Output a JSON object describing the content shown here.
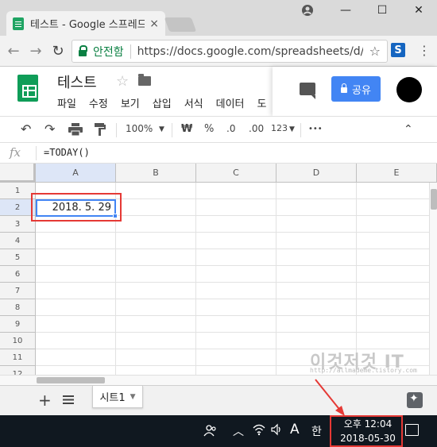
{
  "browser": {
    "tab_title": "테스트 - Google 스프레드",
    "tab_close": "×",
    "security_label": "안전함",
    "url": "https://docs.google.com/spreadsheets/d/...",
    "window_controls": {
      "minimize": "—",
      "maximize": "☐",
      "close": "✕"
    },
    "ext_label": "S"
  },
  "doc": {
    "title": "테스트",
    "menu": [
      "파일",
      "수정",
      "보기",
      "삽입",
      "서식",
      "데이터",
      "도"
    ],
    "share_label": "공유"
  },
  "toolbar": {
    "zoom": "100%",
    "currency": "₩",
    "percent": "%",
    "decimal_dec": ".0",
    "decimal_inc": ".00",
    "more_formats": "123",
    "more": "•••"
  },
  "formula": {
    "fx_label": "fx",
    "content": "=TODAY()"
  },
  "grid": {
    "columns": [
      "A",
      "B",
      "C",
      "D",
      "E"
    ],
    "rows": [
      "1",
      "2",
      "3",
      "4",
      "5",
      "6",
      "7",
      "8",
      "9",
      "10",
      "11",
      "12"
    ],
    "active_cell": {
      "ref": "A2",
      "value": "2018. 5. 29"
    }
  },
  "watermark": {
    "text": "이것저것 IT",
    "url": "http://allmademe.tistory.com"
  },
  "sheets": {
    "tabs": [
      {
        "label": "시트1"
      }
    ]
  },
  "taskbar": {
    "ime_a": "A",
    "ime_han": "한",
    "clock_time": "오후 12:04",
    "clock_date": "2018-05-30"
  },
  "colors": {
    "accent_blue": "#4285f4",
    "sheets_green": "#0f9d58",
    "annotation_red": "#e53935",
    "taskbar_bg": "#101820"
  }
}
